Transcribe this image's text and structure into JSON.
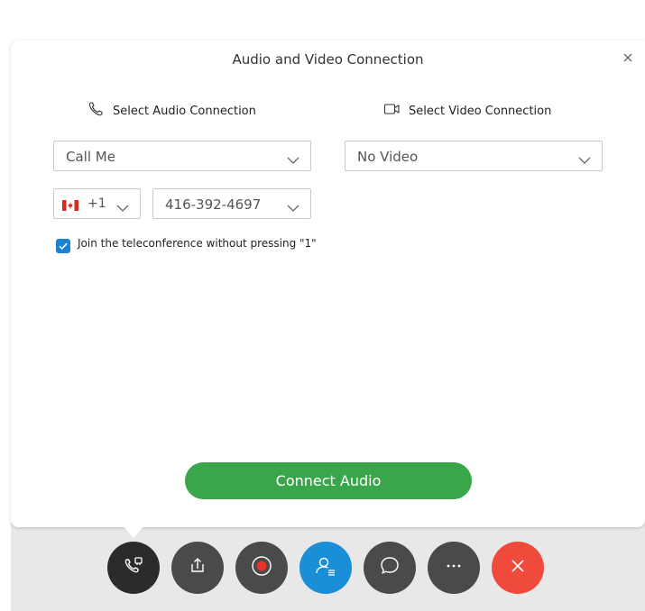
{
  "dialog": {
    "title": "Audio and Video Connection",
    "close_icon": "close-icon"
  },
  "audio": {
    "heading": "Select Audio Connection",
    "heading_icon": "phone-icon",
    "connection_value": "Call Me",
    "country_code": "+1",
    "country_flag": "canada-flag-icon",
    "phone_number": "416-392-4697",
    "join_without_pressing_1": {
      "checked": true,
      "label": "Join the teleconference without pressing \"1\""
    },
    "connect_button": "Connect Audio"
  },
  "video": {
    "heading": "Select Video Connection",
    "heading_icon": "video-camera-icon",
    "connection_value": "No Video"
  },
  "toolbar": [
    {
      "name": "audio-settings",
      "icon": "phone-settings-icon",
      "color": "#2b2b2b"
    },
    {
      "name": "share",
      "icon": "share-icon",
      "color": "#4a4a4a"
    },
    {
      "name": "record",
      "icon": "record-icon",
      "color": "#4a4a4a"
    },
    {
      "name": "participants",
      "icon": "participants-icon",
      "color": "#1a8fd8"
    },
    {
      "name": "chat",
      "icon": "chat-icon",
      "color": "#4a4a4a"
    },
    {
      "name": "more",
      "icon": "more-icon",
      "color": "#4a4a4a"
    },
    {
      "name": "end-meeting",
      "icon": "close-icon",
      "color": "#ef4a3c"
    }
  ],
  "colors": {
    "accent_green": "#3aa64c",
    "checkbox_blue": "#1a82d6",
    "record_red": "#e8332a",
    "end_red": "#ef4a3c"
  }
}
